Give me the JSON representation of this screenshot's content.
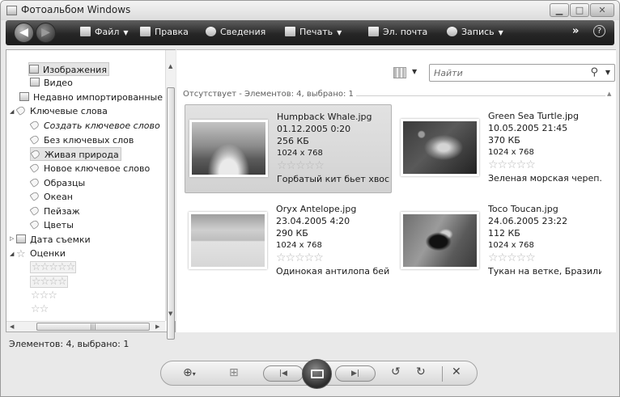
{
  "window": {
    "title": "Фотоальбом Windows"
  },
  "toolbar": {
    "file": "Файл",
    "edit": "Правка",
    "info": "Сведения",
    "print": "Печать",
    "email": "Эл. почта",
    "burn": "Запись",
    "more": "»",
    "help": "?"
  },
  "nav": {
    "images": "Изображения",
    "video": "Видео",
    "recent": "Недавно импортированные",
    "tags": "Ключевые слова",
    "create_tag": "Создать ключевое слово",
    "no_tags": "Без ключевых слов",
    "wildlife": "Живая природа",
    "new_tag": "Новое ключевое слово",
    "samples": "Образцы",
    "ocean": "Океан",
    "landscape": "Пейзаж",
    "flowers": "Цветы",
    "date_taken": "Дата съемки",
    "ratings": "Оценки",
    "star_rows": [
      "☆☆☆☆☆",
      "☆☆☆☆",
      "☆☆☆",
      "☆☆"
    ]
  },
  "search": {
    "placeholder": "Найти"
  },
  "group_header": "Отсутствует - Элементов: 4, выбрано: 1",
  "items": [
    {
      "name": "Humpback Whale.jpg",
      "date": "01.12.2005 0:20",
      "size": "256 КБ",
      "dims": "1024 x 768",
      "rating": "☆☆☆☆☆",
      "caption": "Горбатый кит бьет хвос..."
    },
    {
      "name": "Green Sea Turtle.jpg",
      "date": "10.05.2005 21:45",
      "size": "370 КБ",
      "dims": "1024 x 768",
      "rating": "☆☆☆☆☆",
      "caption": "Зеленая морская череп..."
    },
    {
      "name": "Oryx Antelope.jpg",
      "date": "23.04.2005 4:20",
      "size": "290 КБ",
      "dims": "1024 x 768",
      "rating": "☆☆☆☆☆",
      "caption": "Одинокая антилопа бей..."
    },
    {
      "name": "Toco Toucan.jpg",
      "date": "24.06.2005 23:22",
      "size": "112 КБ",
      "dims": "1024 x 768",
      "rating": "☆☆☆☆☆",
      "caption": "Тукан на ветке, Бразилия."
    }
  ],
  "status": "Элементов: 4, выбрано: 1"
}
